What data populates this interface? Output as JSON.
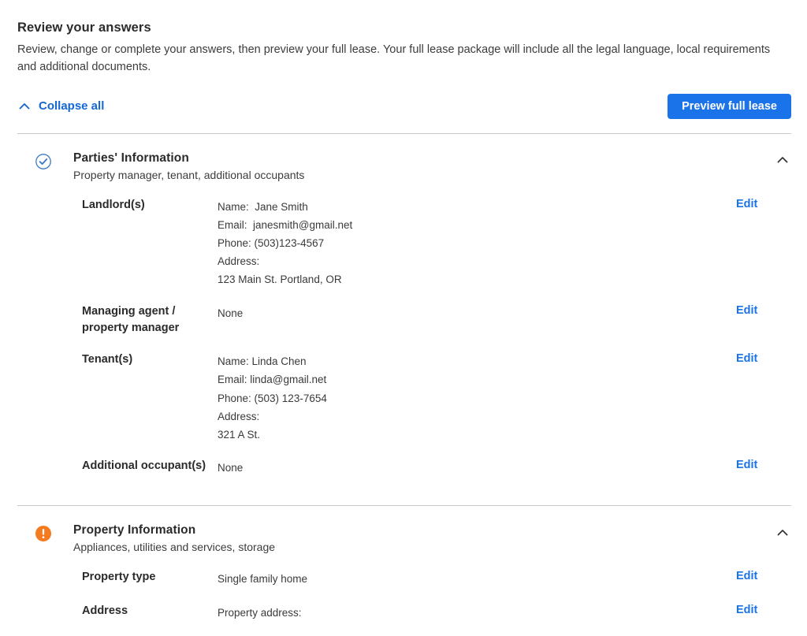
{
  "header": {
    "title": "Review your answers",
    "description": "Review, change or complete your answers, then preview your full lease. Your full lease package will include all the legal language, local requirements and additional documents."
  },
  "actions": {
    "collapse_all_label": "Collapse all",
    "collapse_icon": "chevron-up-icon",
    "preview_button_label": "Preview full lease",
    "primary_color": "#1a73e8",
    "link_color": "#1567d3"
  },
  "sections": [
    {
      "id": "parties-information",
      "title": "Parties' Information",
      "subtitle": "Property manager, tenant, additional occupants",
      "status": "complete",
      "status_icon": "check-circle-icon",
      "status_color": "#3f7cc4",
      "toggle_icon": "chevron-up-icon",
      "rows": [
        {
          "label": "Landlord(s)",
          "value_lines": [
            "Name:  Jane Smith",
            "Email:  janesmith@gmail.net",
            "Phone: (503)123-4567",
            "Address:",
            "123 Main St. Portland, OR"
          ],
          "edit_label": "Edit"
        },
        {
          "label": "Managing agent / property manager",
          "value_lines": [
            "None"
          ],
          "edit_label": "Edit"
        },
        {
          "label": "Tenant(s)",
          "value_lines": [
            "Name: Linda Chen",
            "Email: linda@gmail.net",
            "Phone: (503) 123-7654",
            "Address:",
            "321 A St."
          ],
          "edit_label": "Edit"
        },
        {
          "label": "Additional occupant(s)",
          "value_lines": [
            "None"
          ],
          "edit_label": "Edit"
        }
      ]
    },
    {
      "id": "property-information",
      "title": "Property Information",
      "subtitle": "Appliances, utilities and services, storage",
      "status": "incomplete",
      "status_icon": "exclamation-circle-icon",
      "status_color": "#f47b20",
      "toggle_icon": "chevron-up-icon",
      "rows": [
        {
          "label": "Property type",
          "value_lines": [
            "Single family home"
          ],
          "edit_label": "Edit"
        },
        {
          "label": "Address",
          "value_lines": [
            "Property address:"
          ],
          "edit_label": "Edit"
        }
      ]
    }
  ]
}
